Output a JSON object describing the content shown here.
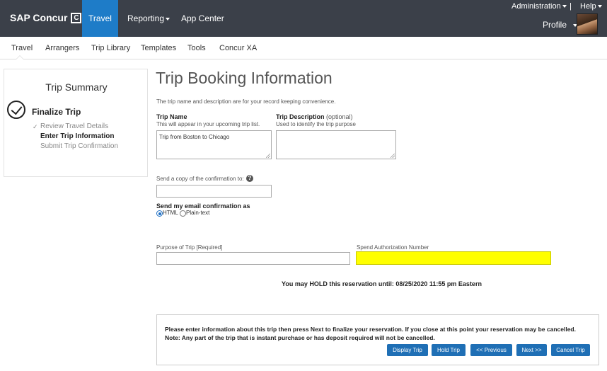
{
  "header": {
    "brand": "SAP Concur",
    "brand_mark": "C",
    "nav": {
      "travel": "Travel",
      "reporting": "Reporting",
      "app_center": "App Center"
    },
    "administration": "Administration",
    "separator": "|",
    "help": "Help",
    "profile": "Profile"
  },
  "subnav": [
    "Travel",
    "Arrangers",
    "Trip Library",
    "Templates",
    "Tools",
    "Concur XA"
  ],
  "sidebar": {
    "title": "Trip Summary",
    "section": "Finalize Trip",
    "steps": [
      "Review Travel Details",
      "Enter Trip Information",
      "Submit Trip Confirmation"
    ],
    "current_step": "Enter Trip Information"
  },
  "main": {
    "title": "Trip Booking Information",
    "intro": "The trip name and description are for your record keeping convenience.",
    "trip_name": {
      "label": "Trip Name",
      "hint": "This will appear in your upcoming trip list.",
      "value": "Trip from Boston to Chicago"
    },
    "trip_description": {
      "label": "Trip Description",
      "optional": "(optional)",
      "hint": "Used to identify the trip purpose",
      "value": ""
    },
    "copy_label": "Send a copy of the confirmation to:",
    "copy_value": "",
    "email_format": {
      "label": "Send my email confirmation as",
      "options": [
        "HTML",
        "Plain-text"
      ],
      "selected": "HTML"
    },
    "purpose": {
      "label": "Purpose of Trip [Required]",
      "value": ""
    },
    "spend_auth": {
      "label": "Spend Authorization Number",
      "value": "",
      "highlight": "#ffff00"
    },
    "hold_notice": "You may HOLD this reservation until: 08/25/2020 11:55 pm Eastern"
  },
  "footer": {
    "line1": "Please enter information about this trip then press Next to finalize your reservation. If you close at this point your reservation may be cancelled.",
    "line2": "Note: Any part of the trip that is instant purchase or has deposit required will not be cancelled.",
    "buttons": {
      "display": "Display Trip",
      "hold": "Hold Trip",
      "previous": "<< Previous",
      "next": "Next >>",
      "cancel": "Cancel Trip"
    }
  },
  "colors": {
    "topbar": "#3b4049",
    "accent": "#1e7cc8",
    "button": "#1f6fb5"
  }
}
